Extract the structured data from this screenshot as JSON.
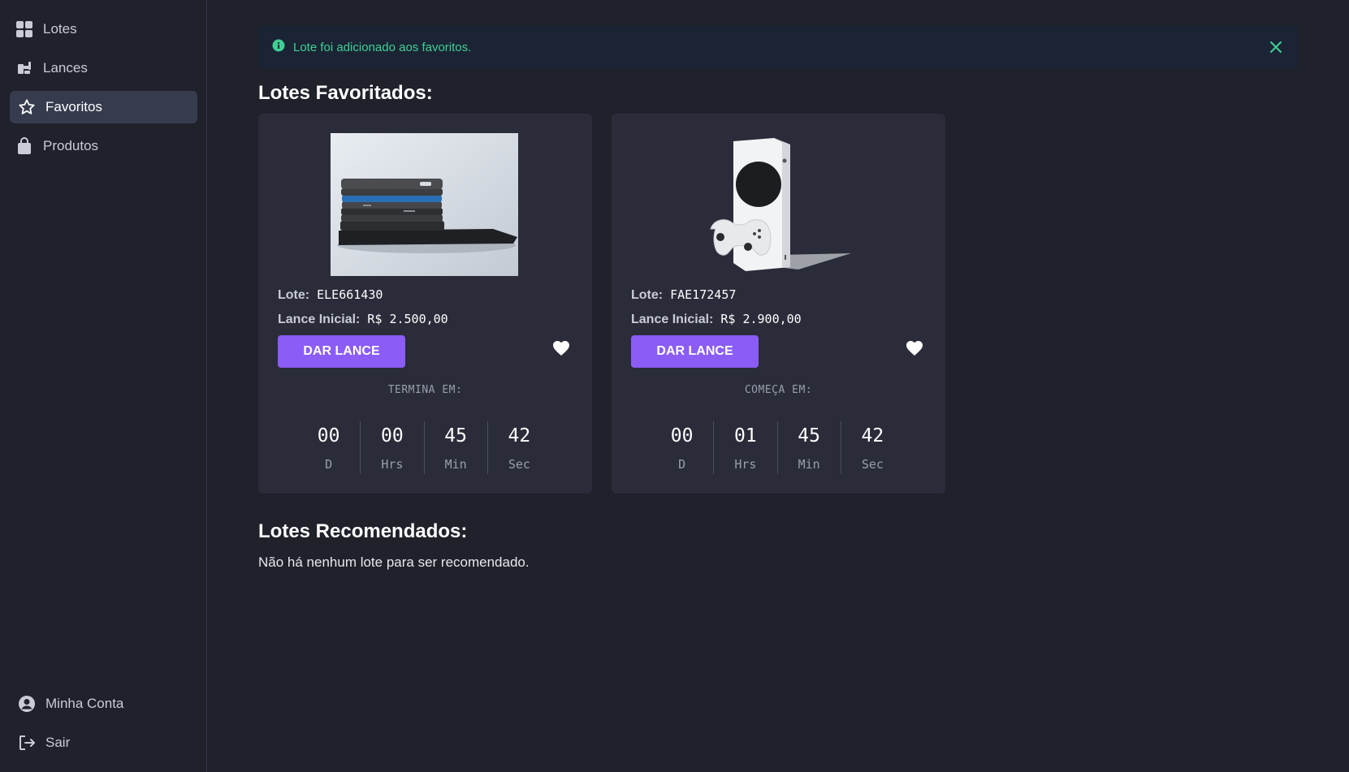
{
  "sidebar": {
    "items": [
      {
        "label": "Lotes",
        "icon": "grid-icon"
      },
      {
        "label": "Lances",
        "icon": "auction-icon"
      },
      {
        "label": "Favoritos",
        "icon": "star-icon",
        "active": true
      },
      {
        "label": "Produtos",
        "icon": "shopping-bag-icon"
      }
    ],
    "account_label": "Minha Conta",
    "logout_label": "Sair"
  },
  "alert": {
    "message": "Lote foi adicionado aos favoritos.",
    "color": "#3fcf95"
  },
  "favorites": {
    "title": "Lotes Favoritados:",
    "cards": [
      {
        "image": "stacked-phones-photo",
        "lot_label": "Lote:",
        "lot_code": "ELE661430",
        "price_label": "Lance Inicial:",
        "price": "R$ 2.500,00",
        "button_label": "DAR LANCE",
        "countdown_label": "TERMINA EM:",
        "timer": [
          {
            "value": "00",
            "unit": "D"
          },
          {
            "value": "00",
            "unit": "Hrs"
          },
          {
            "value": "45",
            "unit": "Min"
          },
          {
            "value": "42",
            "unit": "Sec"
          }
        ]
      },
      {
        "image": "game-console-photo",
        "lot_label": "Lote:",
        "lot_code": "FAE172457",
        "price_label": "Lance Inicial:",
        "price": "R$ 2.900,00",
        "button_label": "DAR LANCE",
        "countdown_label": "COMEÇA EM:",
        "timer": [
          {
            "value": "00",
            "unit": "D"
          },
          {
            "value": "01",
            "unit": "Hrs"
          },
          {
            "value": "45",
            "unit": "Min"
          },
          {
            "value": "42",
            "unit": "Sec"
          }
        ]
      }
    ]
  },
  "recommended": {
    "title": "Lotes Recomendados:",
    "empty_message": "Não há nenhum lote para ser recomendado."
  },
  "colors": {
    "background": "#1f212b",
    "card": "#2a2c3a",
    "accent": "#8b5cf6",
    "active_nav": "#363c4e"
  }
}
